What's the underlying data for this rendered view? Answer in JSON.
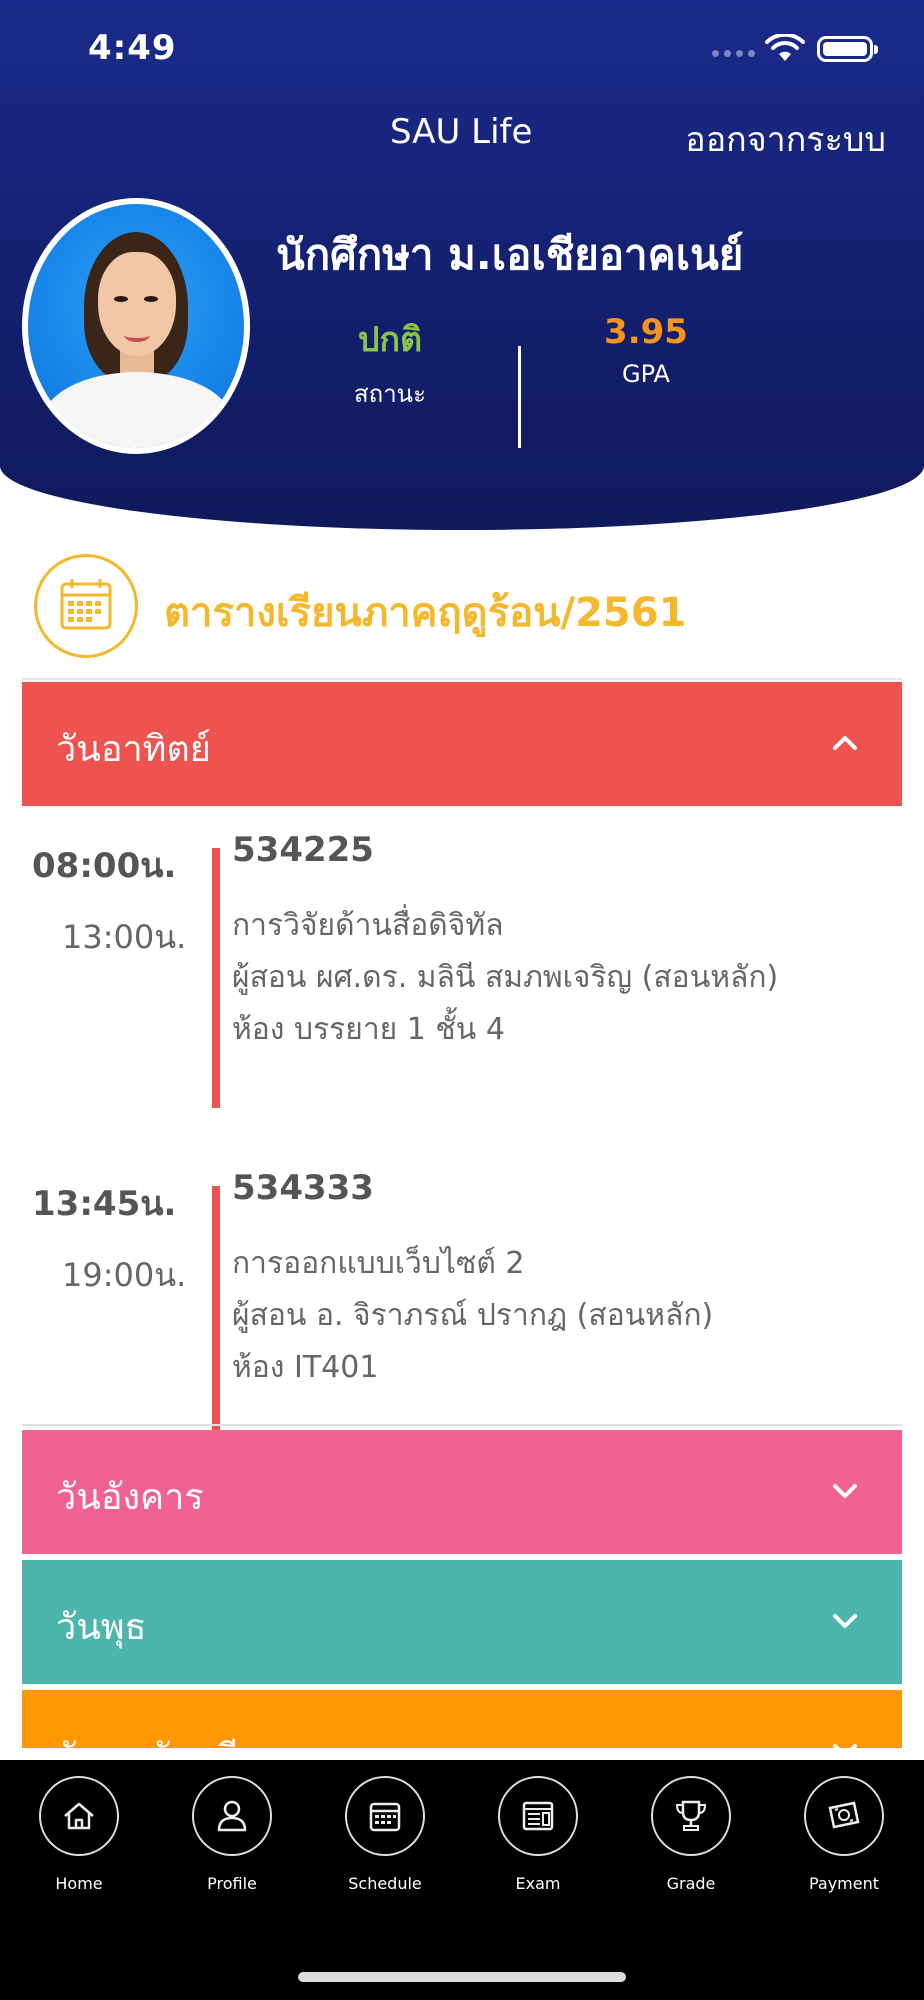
{
  "status_bar": {
    "time": "4:49"
  },
  "header": {
    "app_title": "SAU Life",
    "logout_label": "ออกจากระบบ",
    "student_name": "นักศึกษา ม.เอเชียอาคเนย์",
    "status_value": "ปกติ",
    "status_label": "สถานะ",
    "gpa_value": "3.95",
    "gpa_label": "GPA"
  },
  "schedule": {
    "title": "ตารางเรียนภาคฤดูร้อน/2561",
    "days": [
      {
        "label": "วันอาทิตย์",
        "expanded": true,
        "color": "#ef5350",
        "classes": [
          {
            "start": "08:00น.",
            "end": "13:00น.",
            "code": "534225",
            "name": "การวิจัยด้านสื่อดิจิทัล",
            "instructor": "ผู้สอน ผศ.ดร. มลินี สมภพเจริญ (สอนหลัก)",
            "room": "ห้อง บรรยาย 1 ชั้น 4"
          },
          {
            "start": "13:45น.",
            "end": "19:00น.",
            "code": "534333",
            "name": "การออกแบบเว็บไซต์ 2",
            "instructor": "ผู้สอน อ. จิราภรณ์ ปรากฎ (สอนหลัก)",
            "room": "ห้อง IT401"
          }
        ]
      },
      {
        "label": "วันอังคาร",
        "expanded": false,
        "color": "#f06292"
      },
      {
        "label": "วันพุธ",
        "expanded": false,
        "color": "#4db6ac"
      },
      {
        "label": "วันพฤหัสบดี",
        "expanded": false,
        "color": "#ff9800"
      }
    ]
  },
  "tabs": [
    {
      "label": "Home",
      "icon": "home-icon"
    },
    {
      "label": "Profile",
      "icon": "profile-icon"
    },
    {
      "label": "Schedule",
      "icon": "calendar-icon"
    },
    {
      "label": "Exam",
      "icon": "exam-icon"
    },
    {
      "label": "Grade",
      "icon": "trophy-icon"
    },
    {
      "label": "Payment",
      "icon": "payment-icon"
    }
  ],
  "colors": {
    "header_bg": "#1b2a8c",
    "accent_yellow": "#f5b72b",
    "status_green": "#8bc34a",
    "gpa_orange": "#f7941d"
  }
}
